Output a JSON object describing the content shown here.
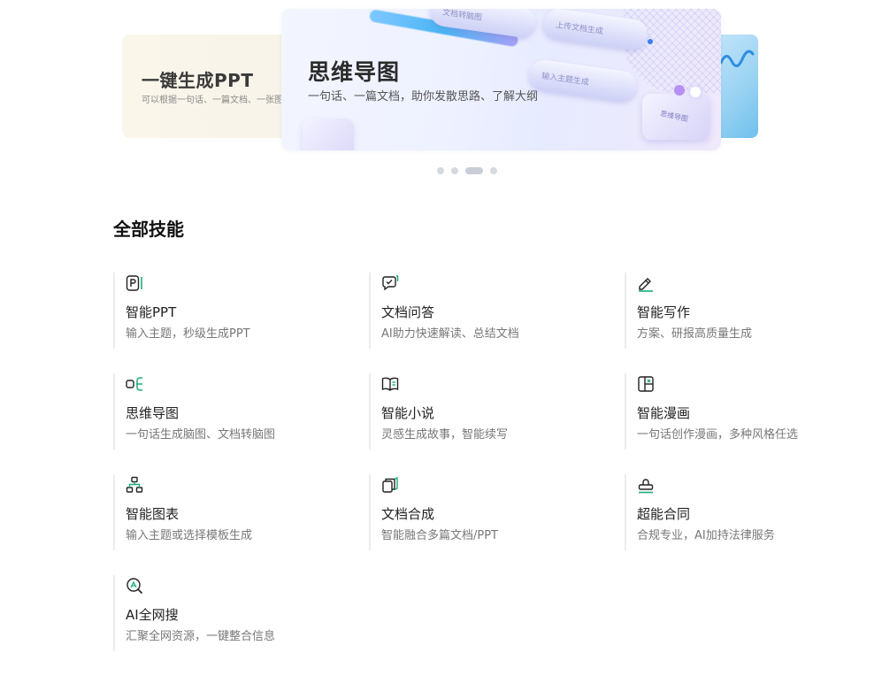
{
  "carousel": {
    "back_slide": {
      "title": "一键生成PPT",
      "desc": "可以根据一句话、一篇文档、一张图"
    },
    "front_slide": {
      "title": "思维导图",
      "desc": "一句话、一篇文档，助你发散思路、了解大纲"
    },
    "deco_pills": [
      "文档转脑图",
      "上传文档生成",
      "输入主题生成"
    ],
    "deco_brand": "思维导图",
    "active_index": 2,
    "count": 4
  },
  "section": {
    "title": "全部技能"
  },
  "skills": [
    {
      "name": "智能PPT",
      "desc": "输入主题，秒级生成PPT",
      "icon": "ppt-icon"
    },
    {
      "name": "文档问答",
      "desc": "AI助力快速解读、总结文档",
      "icon": "chat-check-icon"
    },
    {
      "name": "智能写作",
      "desc": "方案、研报高质量生成",
      "icon": "pen-icon"
    },
    {
      "name": "思维导图",
      "desc": "一句话生成脑图、文档转脑图",
      "icon": "mindmap-icon"
    },
    {
      "name": "智能小说",
      "desc": "灵感生成故事，智能续写",
      "icon": "book-icon"
    },
    {
      "name": "智能漫画",
      "desc": "一句话创作漫画，多种风格任选",
      "icon": "comic-panel-icon"
    },
    {
      "name": "智能图表",
      "desc": "输入主题或选择模板生成",
      "icon": "org-chart-icon"
    },
    {
      "name": "文档合成",
      "desc": "智能融合多篇文档/PPT",
      "icon": "stacked-docs-icon"
    },
    {
      "name": "超能合同",
      "desc": "合规专业，AI加持法律服务",
      "icon": "stamp-icon"
    },
    {
      "name": "AI全网搜",
      "desc": "汇聚全网资源，一键整合信息",
      "icon": "ai-search-icon"
    }
  ],
  "colors": {
    "accent": "#1aad7c",
    "icon_stroke": "#222222",
    "muted_text": "#777777"
  }
}
